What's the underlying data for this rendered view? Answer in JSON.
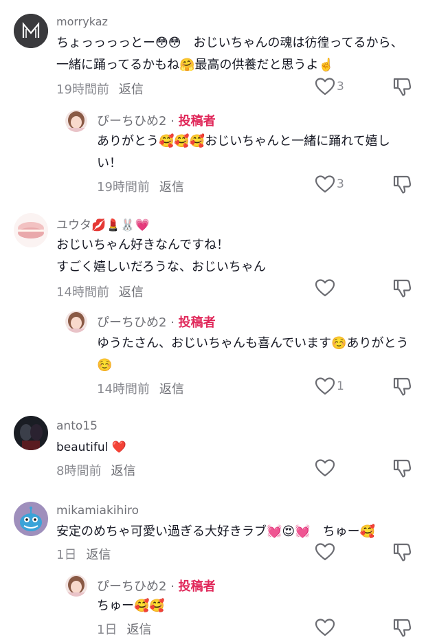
{
  "comments": [
    {
      "username": "morrykaz",
      "text": "ちょっっっっとー😳😳　おじいちゃんの魂は彷徨ってるから、一緒に踊ってるかもね🤗最高の供養だと思うよ☝️",
      "time": "19時間前",
      "reply_label": "返信",
      "likes": "3"
    },
    {
      "username": "ぴーちひめ2",
      "author_tag": "投稿者",
      "text": "ありがとう🥰🥰🥰おじいちゃんと一緒に踊れて嬉しい！",
      "time": "19時間前",
      "reply_label": "返信",
      "likes": "3"
    },
    {
      "username": "ユウタ💋💄🐰💗",
      "text": "おじいちゃん好きなんですね！\nすごく嬉しいだろうな、おじいちゃん",
      "time": "14時間前",
      "reply_label": "返信",
      "likes": ""
    },
    {
      "username": "ぴーちひめ2",
      "author_tag": "投稿者",
      "text": "ゆうたさん、おじいちゃんも喜んでいます☺️ありがとう☺️",
      "time": "14時間前",
      "reply_label": "返信",
      "likes": "1"
    },
    {
      "username": "anto15",
      "text": "beautiful ❤️",
      "time": "8時間前",
      "reply_label": "返信",
      "likes": ""
    },
    {
      "username": "mikamiakihiro",
      "text": "安定のめちゃ可愛い過ぎる大好きラブ💓😍💓　ちゅー🥰",
      "time": "1日",
      "reply_label": "返信",
      "likes": ""
    },
    {
      "username": "ぴーちひめ2",
      "author_tag": "投稿者",
      "text": "ちゅー🥰🥰",
      "time": "1日",
      "reply_label": "返信",
      "likes": ""
    }
  ],
  "separator": "·",
  "icons": {
    "like": "heart-outline-icon",
    "dislike": "thumbs-down-outline-icon"
  },
  "colors": {
    "author_tag": "#e0285a",
    "meta": "#8a8b91",
    "text": "#161823"
  }
}
